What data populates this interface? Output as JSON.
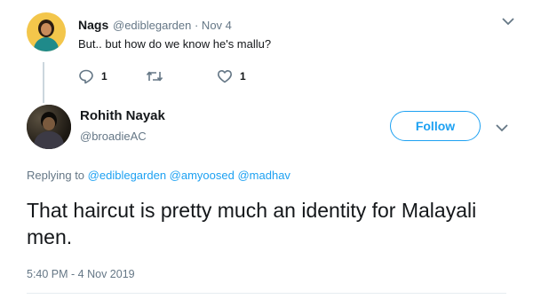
{
  "parent_tweet": {
    "name": "Nags",
    "meta": "@ediblegarden · Nov 4",
    "text": "But.. but how do we know he's mallu?",
    "reply_count": "1",
    "like_count": "1"
  },
  "main_tweet": {
    "name": "Rohith Nayak",
    "handle": "@broadieAC",
    "follow_label": "Follow",
    "replying_to_label": "Replying to",
    "mentions": [
      "@ediblegarden",
      "@amyoosed",
      "@madhav"
    ],
    "text": "That haircut is pretty much an identity for Malayali men.",
    "timestamp": "5:40 PM - 4 Nov 2019"
  },
  "colors": {
    "accent": "#1da1f2",
    "secondary_text": "#657786",
    "primary_text": "#14171a"
  },
  "icons": [
    "reply-icon",
    "retweet-icon",
    "like-icon",
    "chevron-down-icon"
  ]
}
